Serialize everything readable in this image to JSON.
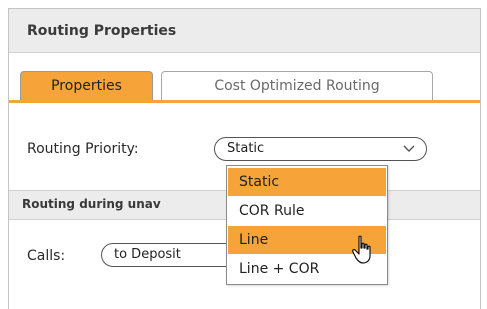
{
  "panel": {
    "title": "Routing Properties"
  },
  "tabs": [
    {
      "label": "Properties",
      "active": true
    },
    {
      "label": "Cost Optimized Routing",
      "active": false
    }
  ],
  "routing_priority": {
    "label": "Routing Priority:",
    "value": "Static",
    "icon": "chevron-down-icon"
  },
  "unavailable_section": {
    "title": "Routing during unav"
  },
  "calls": {
    "label": "Calls:",
    "value": "to Deposit"
  },
  "dropdown": {
    "options": [
      "Static",
      "COR Rule",
      "Line",
      "Line + COR"
    ],
    "selected": "Static",
    "hovered": "Line"
  },
  "colors": {
    "accent": "#f6a33a",
    "header_bg": "#ececec",
    "border": "#c4c4c4"
  }
}
